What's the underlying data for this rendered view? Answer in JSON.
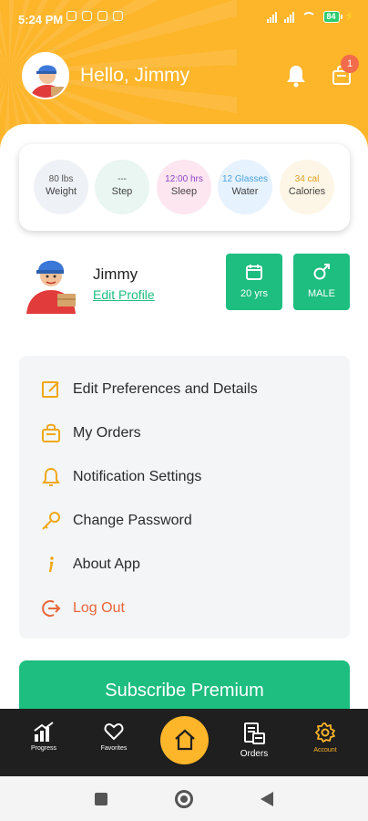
{
  "status_bar": {
    "time": "5:24 PM",
    "battery": "84"
  },
  "header": {
    "greeting": "Hello, Jimmy",
    "cart_badge": "1"
  },
  "stats": [
    {
      "value": "80 lbs",
      "label": "Weight",
      "bg": "#eef1f5",
      "value_color": "#555555"
    },
    {
      "value": "---",
      "label": "Step",
      "bg": "#e9f6f1",
      "value_color": "#555555"
    },
    {
      "value": "12:00 hrs",
      "label": "Sleep",
      "bg": "#fde6f0",
      "value_color": "#8e44c8"
    },
    {
      "value": "12 Glasses",
      "label": "Water",
      "bg": "#e6f2fd",
      "value_color": "#4aa3df"
    },
    {
      "value": "34 cal",
      "label": "Calories",
      "bg": "#fdf6e6",
      "value_color": "#e0a020"
    }
  ],
  "profile": {
    "name": "Jimmy",
    "edit_label": "Edit Profile",
    "age": "20 yrs",
    "gender": "MALE"
  },
  "menu": [
    {
      "label": "Edit Preferences and Details",
      "icon": "edit-icon"
    },
    {
      "label": "My Orders",
      "icon": "orders-icon"
    },
    {
      "label": "Notification Settings",
      "icon": "bell-icon"
    },
    {
      "label": "Change Password",
      "icon": "key-icon"
    },
    {
      "label": "About App",
      "icon": "info-icon"
    },
    {
      "label": "Log Out",
      "icon": "logout-icon"
    }
  ],
  "subscribe_label": "Subscribe Premium",
  "nav": {
    "progress": "Progress",
    "favorites": "Favorites",
    "orders": "Orders",
    "account": "Account"
  },
  "colors": {
    "primary": "#fdb52a",
    "accent": "#1ebd80",
    "danger": "#e8663a",
    "nav_bg": "#1f1f1f"
  }
}
